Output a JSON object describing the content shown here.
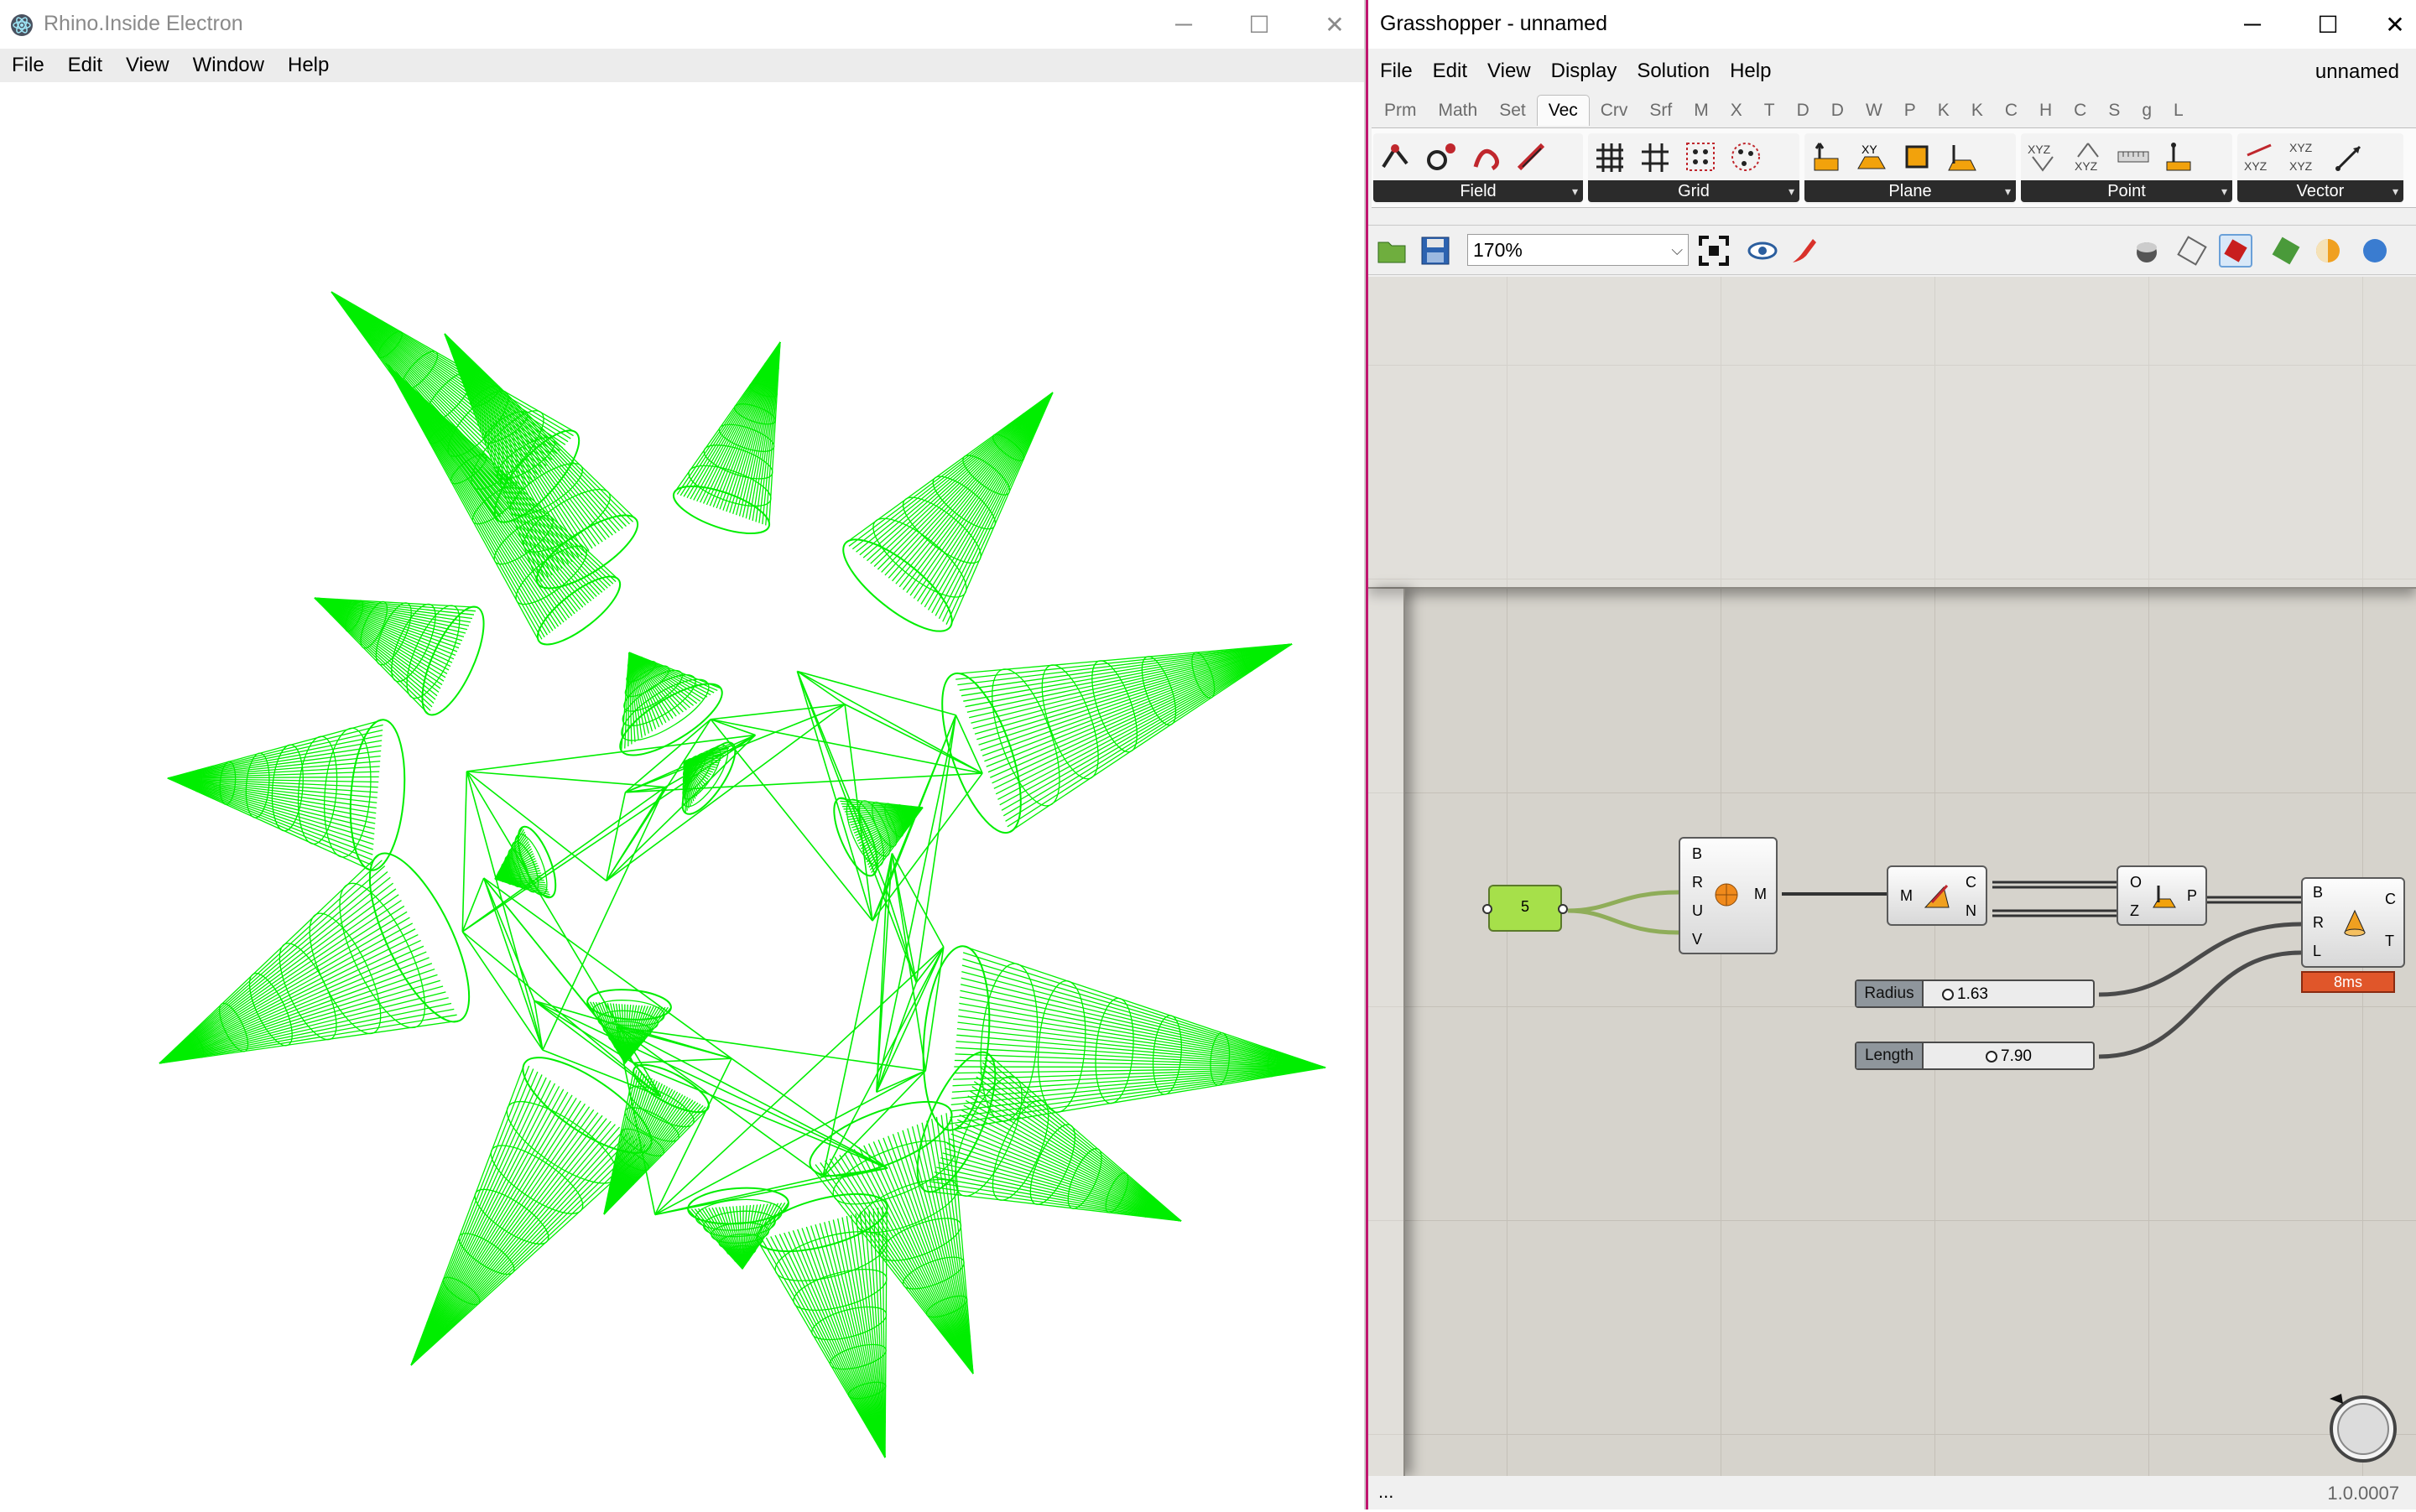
{
  "left_window": {
    "title": "Rhino.Inside Electron",
    "menu": [
      "File",
      "Edit",
      "View",
      "Window",
      "Help"
    ],
    "controls": {
      "minimize": "─",
      "maximize": "☐",
      "close": "✕"
    },
    "geometry_color": "#00ee00"
  },
  "right_window": {
    "title": "Grasshopper - unnamed",
    "controls": {
      "minimize": "─",
      "maximize": "☐",
      "close": "✕"
    },
    "menu": [
      "File",
      "Edit",
      "View",
      "Display",
      "Solution",
      "Help"
    ],
    "document_name": "unnamed",
    "tabs": [
      "Prm",
      "Math",
      "Set",
      "Vec",
      "Crv",
      "Srf",
      "M",
      "X",
      "T",
      "D",
      "D",
      "W",
      "P",
      "K",
      "K",
      "C",
      "H",
      "C",
      "S",
      "g",
      "L"
    ],
    "active_tab": "Vec",
    "ribbon_groups": [
      "Field",
      "Grid",
      "Plane",
      "Point",
      "Vector"
    ],
    "zoom": "170%",
    "nodes": {
      "number_value": "5",
      "sphere_inputs": [
        "B",
        "R",
        "U",
        "V"
      ],
      "sphere_output": "M",
      "evaluate_input": "M",
      "evaluate_outputs": [
        "C",
        "N"
      ],
      "plane_inputs": [
        "O",
        "Z"
      ],
      "plane_output": "P",
      "cone_inputs": [
        "B",
        "R",
        "L"
      ],
      "cone_outputs": [
        "C",
        "T"
      ],
      "cone_time": "8ms"
    },
    "sliders": [
      {
        "label": "Radius",
        "value": "1.63"
      },
      {
        "label": "Length",
        "value": "7.90"
      }
    ],
    "status_left": "...",
    "version": "1.0.0007",
    "colors": {
      "accent_border": "#c0166f",
      "canvas": "#d6d3cc",
      "time_badge": "#e0562a",
      "number_node": "#a6e04a"
    }
  }
}
